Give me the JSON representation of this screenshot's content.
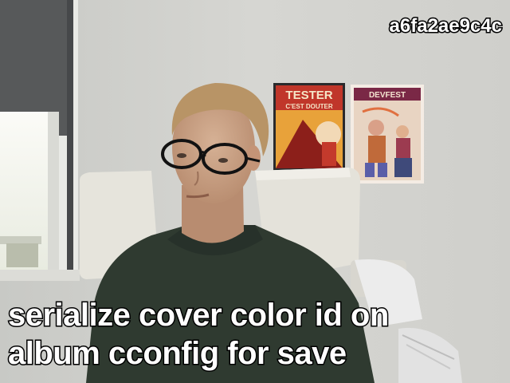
{
  "overlay": {
    "hash": "a6fa2ae9c4c",
    "caption_lines": [
      "serialize cover color id on",
      "album cconfig for save"
    ]
  },
  "posters": {
    "left": {
      "title": "TESTER",
      "subtitle": "C'EST DOUTER"
    },
    "right": {
      "title": "DEVFEST"
    }
  },
  "colors": {
    "wall": "#d4d4d0",
    "window_light": "#f3f4ee",
    "blind": "#57595a",
    "chair": "#e6e4dc",
    "sweater": "#2f3a30",
    "skin": "#c9a285",
    "hair": "#b89466",
    "poster_left_bg": "#c0362a",
    "poster_right_bg": "#e8d4c2"
  }
}
